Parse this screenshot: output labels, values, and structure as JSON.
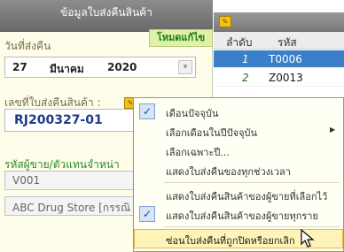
{
  "panel": {
    "title": "ข้อมูลใบส่งคืนสินค้า",
    "mode_badge": "โหมดแก้ไข"
  },
  "form": {
    "return_date_label": "วันที่ส่งคืน",
    "date": {
      "day": "27",
      "month": "มีนาคม",
      "year": "2020"
    },
    "doc_no_label": "เลขที่ใบส่งคืนสินค้า :",
    "doc_no": "RJ200327-01",
    "vendor_label": "รหัสผู้ขาย/ตัวแทนจำหน่า",
    "vendor_code": "V001",
    "vendor_name": "ABC Drug Store [กรรณิ"
  },
  "list": {
    "columns": [
      "ลำดับ",
      "รหัส"
    ],
    "rows": [
      {
        "num": "1",
        "code": "T0006",
        "selected": true
      },
      {
        "num": "2",
        "code": "Z0013",
        "selected": false
      }
    ]
  },
  "menu": {
    "items": [
      {
        "label": "เดือนปัจจุบัน",
        "checked": true,
        "submenu": false
      },
      {
        "label": "เลือกเดือนในปีปัจจุบัน",
        "checked": false,
        "submenu": true
      },
      {
        "label": "เลือกเฉพาะปี...",
        "checked": false,
        "submenu": false
      },
      {
        "label": "แสดงใบส่งคืนของทุกช่วงเวลา",
        "checked": false,
        "submenu": false
      },
      {
        "label": "แสดงใบส่งคืนสินค้าของผู้ขายที่เลือกไว้",
        "checked": false,
        "submenu": false
      },
      {
        "label": "แสดงใบส่งคืนสินค้าของผู้ขายทุกราย",
        "checked": true,
        "submenu": false
      },
      {
        "label": "ซ่อนใบส่งคืนที่ถูกปิดหรือยกเลิก",
        "checked": false,
        "submenu": false,
        "highlighted": true
      }
    ]
  },
  "colors": {
    "selected_row": "#3a7fc8",
    "doc_no_text": "#1f3a8a",
    "vendor_label": "#2d8a2d",
    "highlight": "#fff4b8"
  }
}
